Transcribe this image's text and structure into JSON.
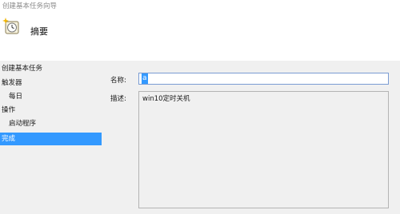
{
  "window": {
    "title": "创建基本任务向导"
  },
  "header": {
    "title": "摘要",
    "icon": "task-scheduler-icon"
  },
  "sidebar": {
    "items": [
      {
        "label": "创建基本任务"
      },
      {
        "label": "触发器"
      },
      {
        "label": "每日"
      },
      {
        "label": "操作"
      },
      {
        "label": "启动程序"
      },
      {
        "label": "完成"
      }
    ],
    "selected_index": 5
  },
  "form": {
    "name_label": "名称:",
    "name_value": "a",
    "description_label": "描述:",
    "description_value": "win10定时关机"
  },
  "colors": {
    "selection": "#3399ff",
    "panel_bg": "#f0f0f0",
    "input_border": "#7a9cd3"
  }
}
